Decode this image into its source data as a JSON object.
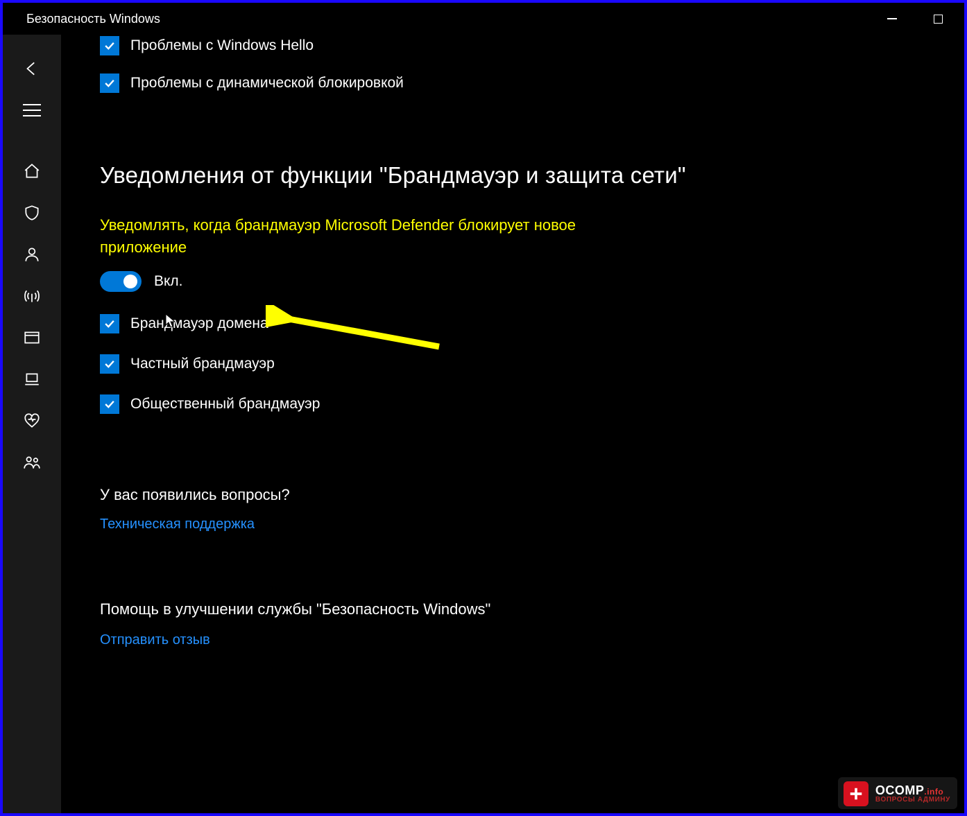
{
  "window": {
    "title": "Безопасность Windows"
  },
  "top_checks": [
    {
      "label": "Проблемы с Windows Hello"
    },
    {
      "label": "Проблемы с динамической блокировкой"
    }
  ],
  "section": {
    "heading": "Уведомления от функции \"Брандмауэр и защита сети\"",
    "highlight_text": "Уведомлять, когда брандмауэр Microsoft Defender блокирует новое приложение",
    "toggle_state_label": "Вкл.",
    "sub_checks": [
      {
        "label": "Брандмауэр домена"
      },
      {
        "label": "Частный брандмауэр"
      },
      {
        "label": "Общественный брандмауэр"
      }
    ]
  },
  "help": {
    "questions_heading": "У вас появились вопросы?",
    "support_link": "Техническая поддержка",
    "improve_heading": "Помощь в улучшении службы \"Безопасность Windows\"",
    "feedback_link": "Отправить отзыв"
  },
  "watermark": {
    "brand": "OCOMP",
    "tld": ".info",
    "tagline": "ВОПРОСЫ АДМИНУ"
  }
}
